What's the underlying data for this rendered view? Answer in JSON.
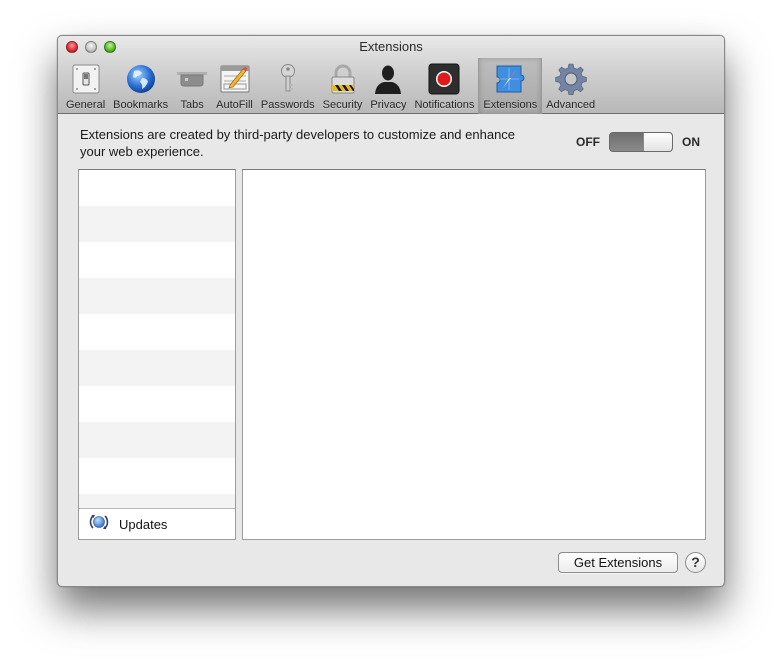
{
  "window": {
    "title": "Extensions",
    "controls": [
      "close",
      "minimize",
      "zoom"
    ]
  },
  "toolbar": {
    "items": [
      {
        "label": "General",
        "icon": "light-switch-icon",
        "selected": false
      },
      {
        "label": "Bookmarks",
        "icon": "globe-icon",
        "selected": false
      },
      {
        "label": "Tabs",
        "icon": "tabs-icon",
        "selected": false
      },
      {
        "label": "AutoFill",
        "icon": "form-pencil-icon",
        "selected": false
      },
      {
        "label": "Passwords",
        "icon": "key-icon",
        "selected": false
      },
      {
        "label": "Security",
        "icon": "padlock-icon",
        "selected": false
      },
      {
        "label": "Privacy",
        "icon": "person-silhouette-icon",
        "selected": false
      },
      {
        "label": "Notifications",
        "icon": "notification-badge-icon",
        "selected": false
      },
      {
        "label": "Extensions",
        "icon": "compass-puzzle-icon",
        "selected": true
      },
      {
        "label": "Advanced",
        "icon": "gear-icon",
        "selected": false
      }
    ]
  },
  "content": {
    "description": "Extensions are created by third-party developers to customize and enhance your web experience.",
    "toggle": {
      "off_label": "OFF",
      "on_label": "ON",
      "state": "ON"
    },
    "extensions_list": {
      "items": [],
      "footer_label": "Updates",
      "footer_icon": "updates-refresh-icon"
    },
    "get_extensions_label": "Get Extensions",
    "help_label": "?"
  }
}
